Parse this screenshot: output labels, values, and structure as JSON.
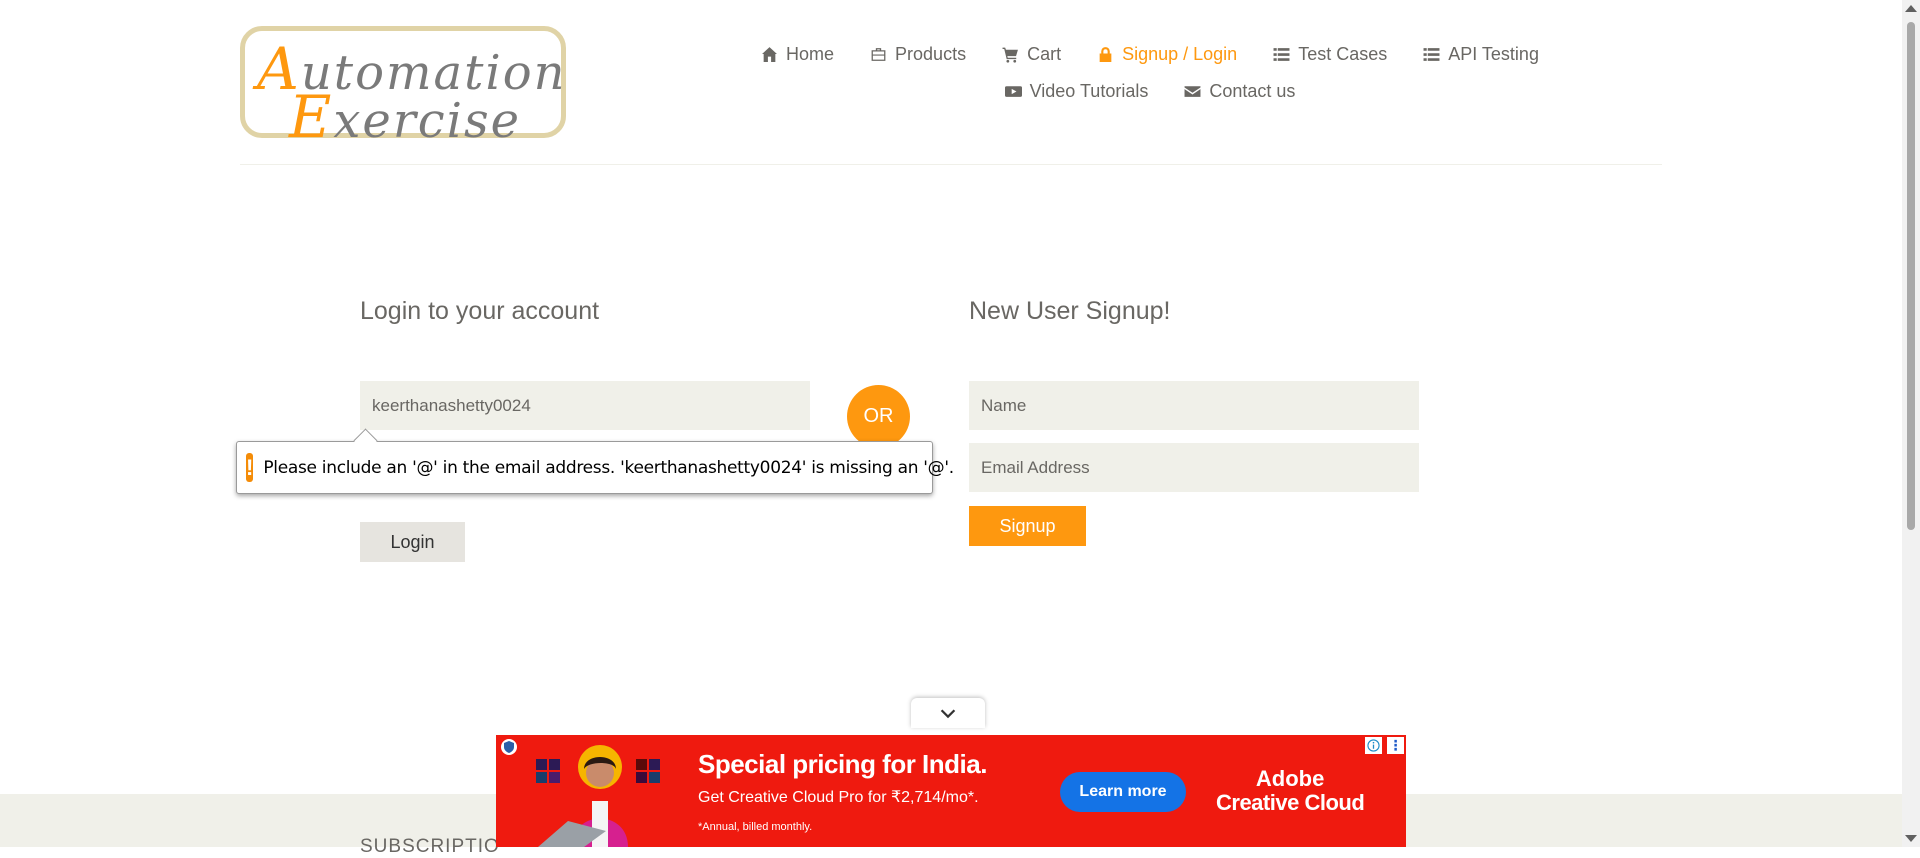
{
  "logo": {
    "line1_cap": "A",
    "line1_rest": "utomation",
    "line2_cap": "E",
    "line2_rest": "xercise"
  },
  "nav": {
    "row1": [
      {
        "label": "Home",
        "icon": "home-icon",
        "active": false
      },
      {
        "label": "Products",
        "icon": "briefcase-icon",
        "active": false
      },
      {
        "label": "Cart",
        "icon": "cart-icon",
        "active": false
      },
      {
        "label": "Signup / Login",
        "icon": "lock-icon",
        "active": true
      },
      {
        "label": "Test Cases",
        "icon": "list-icon",
        "active": false
      },
      {
        "label": "API Testing",
        "icon": "list-icon",
        "active": false
      }
    ],
    "row2": [
      {
        "label": "Video Tutorials",
        "icon": "youtube-icon",
        "active": false
      },
      {
        "label": "Contact us",
        "icon": "envelope-icon",
        "active": false
      }
    ]
  },
  "login": {
    "title": "Login to your account",
    "email_value": "keerthanashetty0024",
    "button": "Login"
  },
  "or_label": "OR",
  "signup": {
    "title": "New User Signup!",
    "name_placeholder": "Name",
    "email_placeholder": "Email Address",
    "button": "Signup"
  },
  "validation": {
    "icon": "warning-icon",
    "message": "Please include an '@' in the email address. 'keerthanashetty0024' is missing an '@'."
  },
  "footer": {
    "subscription_label": "SUBSCRIPTIO"
  },
  "ad": {
    "headline": "Special pricing for India.",
    "sub": "Get Creative Cloud Pro for ₹2,714/mo*.",
    "fine": "*Annual, billed monthly.",
    "cta": "Learn more",
    "brand_line1": "Adobe",
    "brand_line2": "Creative Cloud"
  },
  "colors": {
    "accent": "#fe980f",
    "text": "#696763",
    "field_bg": "#f0f0e9",
    "ad_bg": "#ef1a0f",
    "ad_button": "#1473e6"
  }
}
